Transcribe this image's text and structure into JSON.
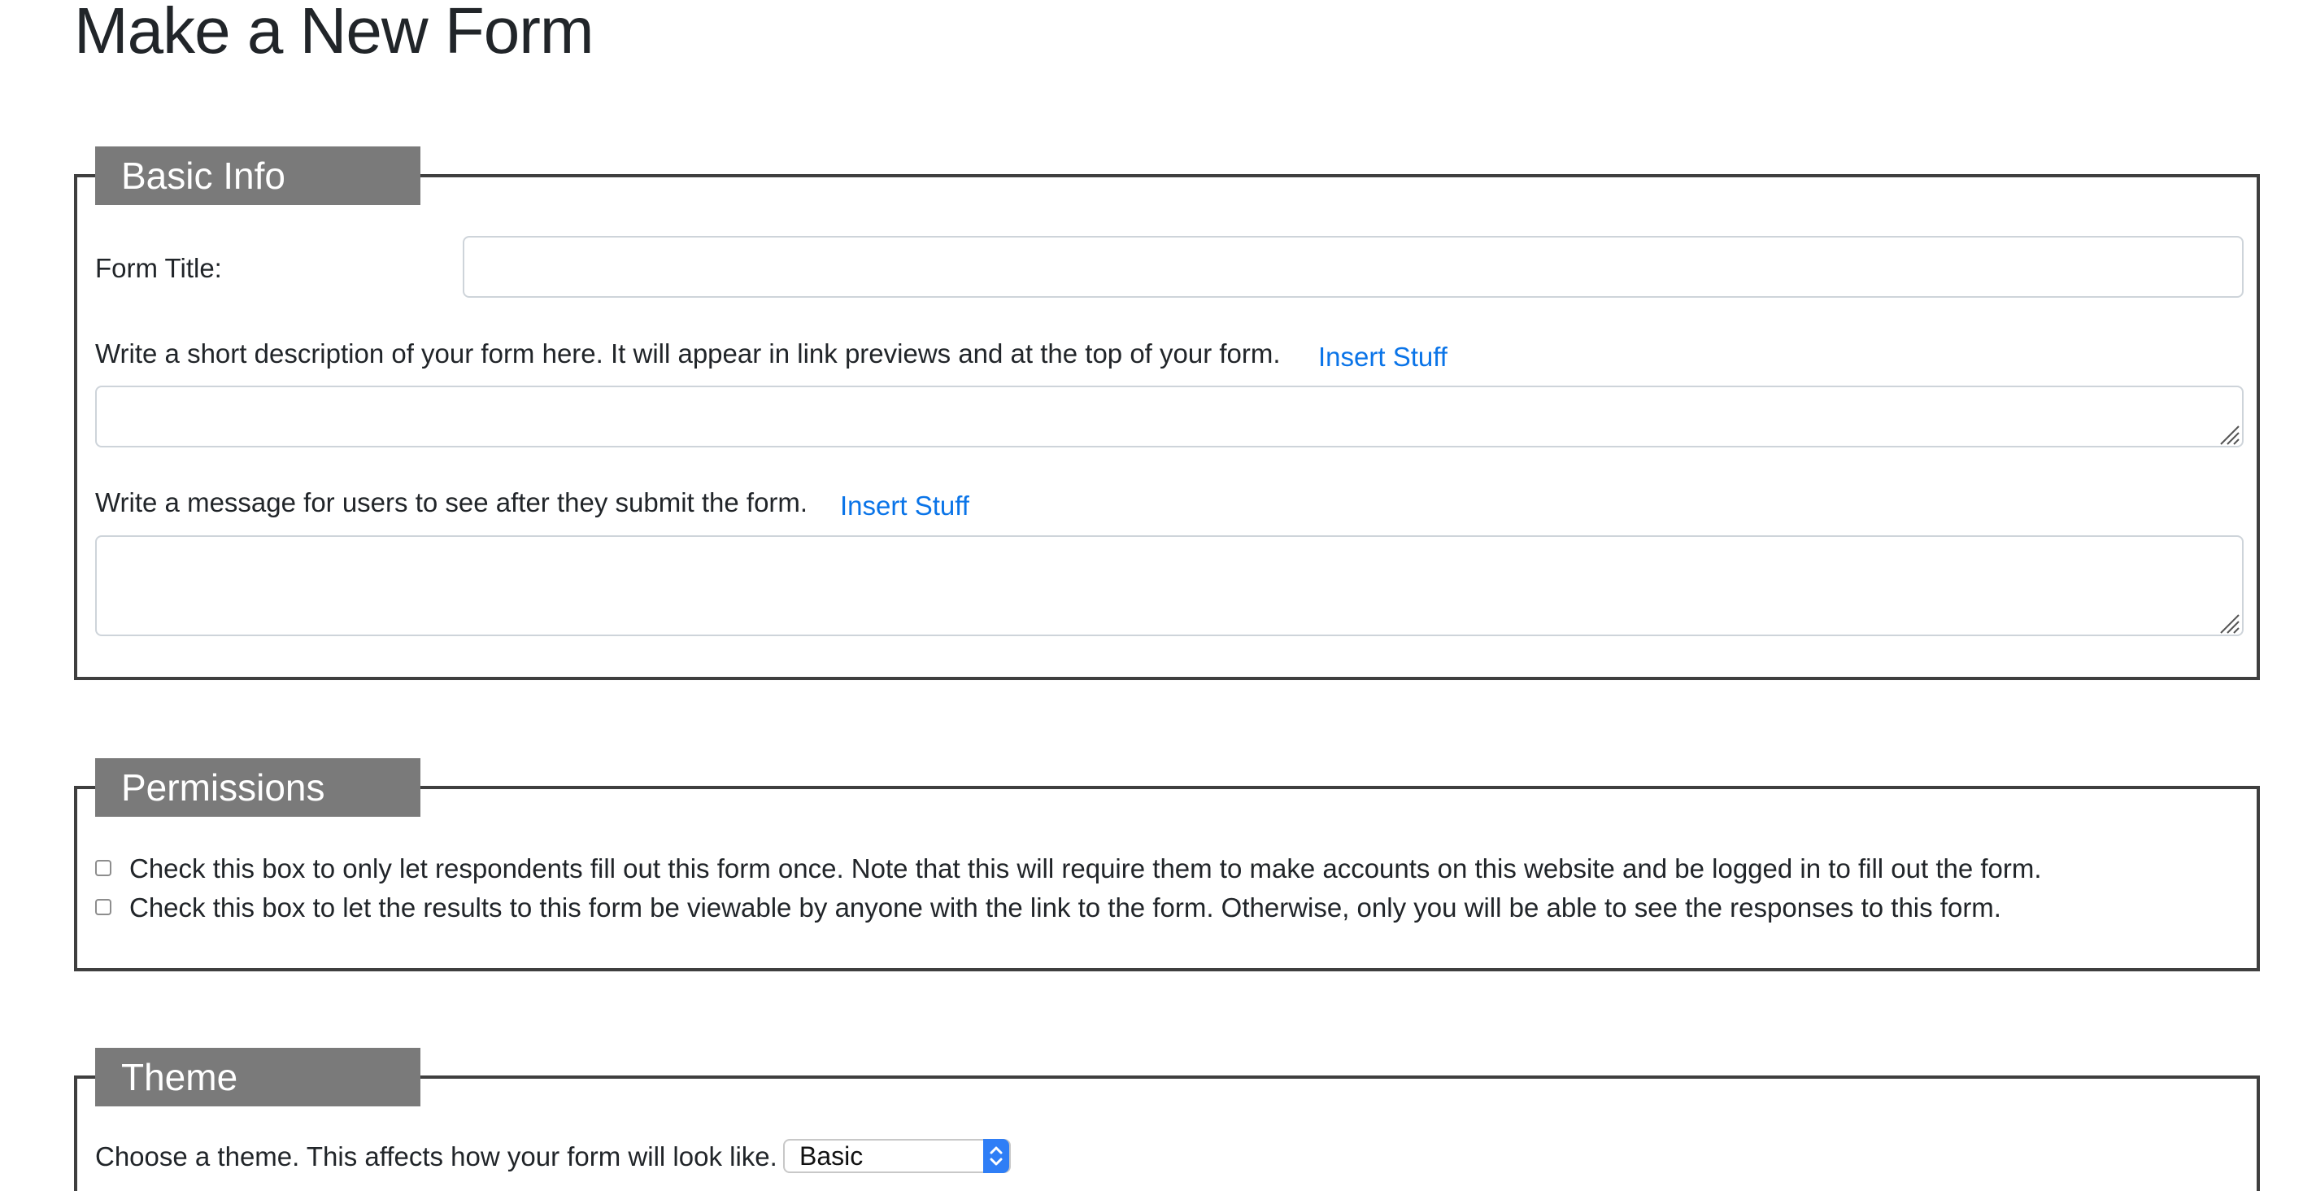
{
  "page": {
    "title": "Make a New Form"
  },
  "basic_info": {
    "legend": "Basic Info",
    "form_title_label": "Form Title:",
    "form_title_value": "",
    "description_label": "Write a short description of your form here. It will appear in link previews and at the top of your form.",
    "description_insert_link": "Insert Stuff",
    "description_value": "",
    "message_label": "Write a message for users to see after they submit the form.",
    "message_insert_link": "Insert Stuff",
    "message_value": ""
  },
  "permissions": {
    "legend": "Permissions",
    "checkboxes": [
      {
        "label": "Check this box to only let respondents fill out this form once. Note that this will require them to make accounts on this website and be logged in to fill out the form.",
        "checked": false
      },
      {
        "label": "Check this box to let the results to this form be viewable by anyone with the link to the form. Otherwise, only you will be able to see the responses to this form.",
        "checked": false
      }
    ]
  },
  "theme": {
    "legend": "Theme",
    "label": "Choose a theme. This affects how your form will look like.",
    "selected": "Basic"
  },
  "colors": {
    "link": "#0a74e8",
    "legend_bg": "#7a7a7a",
    "fieldset_border": "#3f3f3f",
    "select_accent": "#2f7ef6"
  },
  "icons": {
    "resize_grip": "resize-grip-icon",
    "select_arrows": "select-arrows-icon"
  }
}
